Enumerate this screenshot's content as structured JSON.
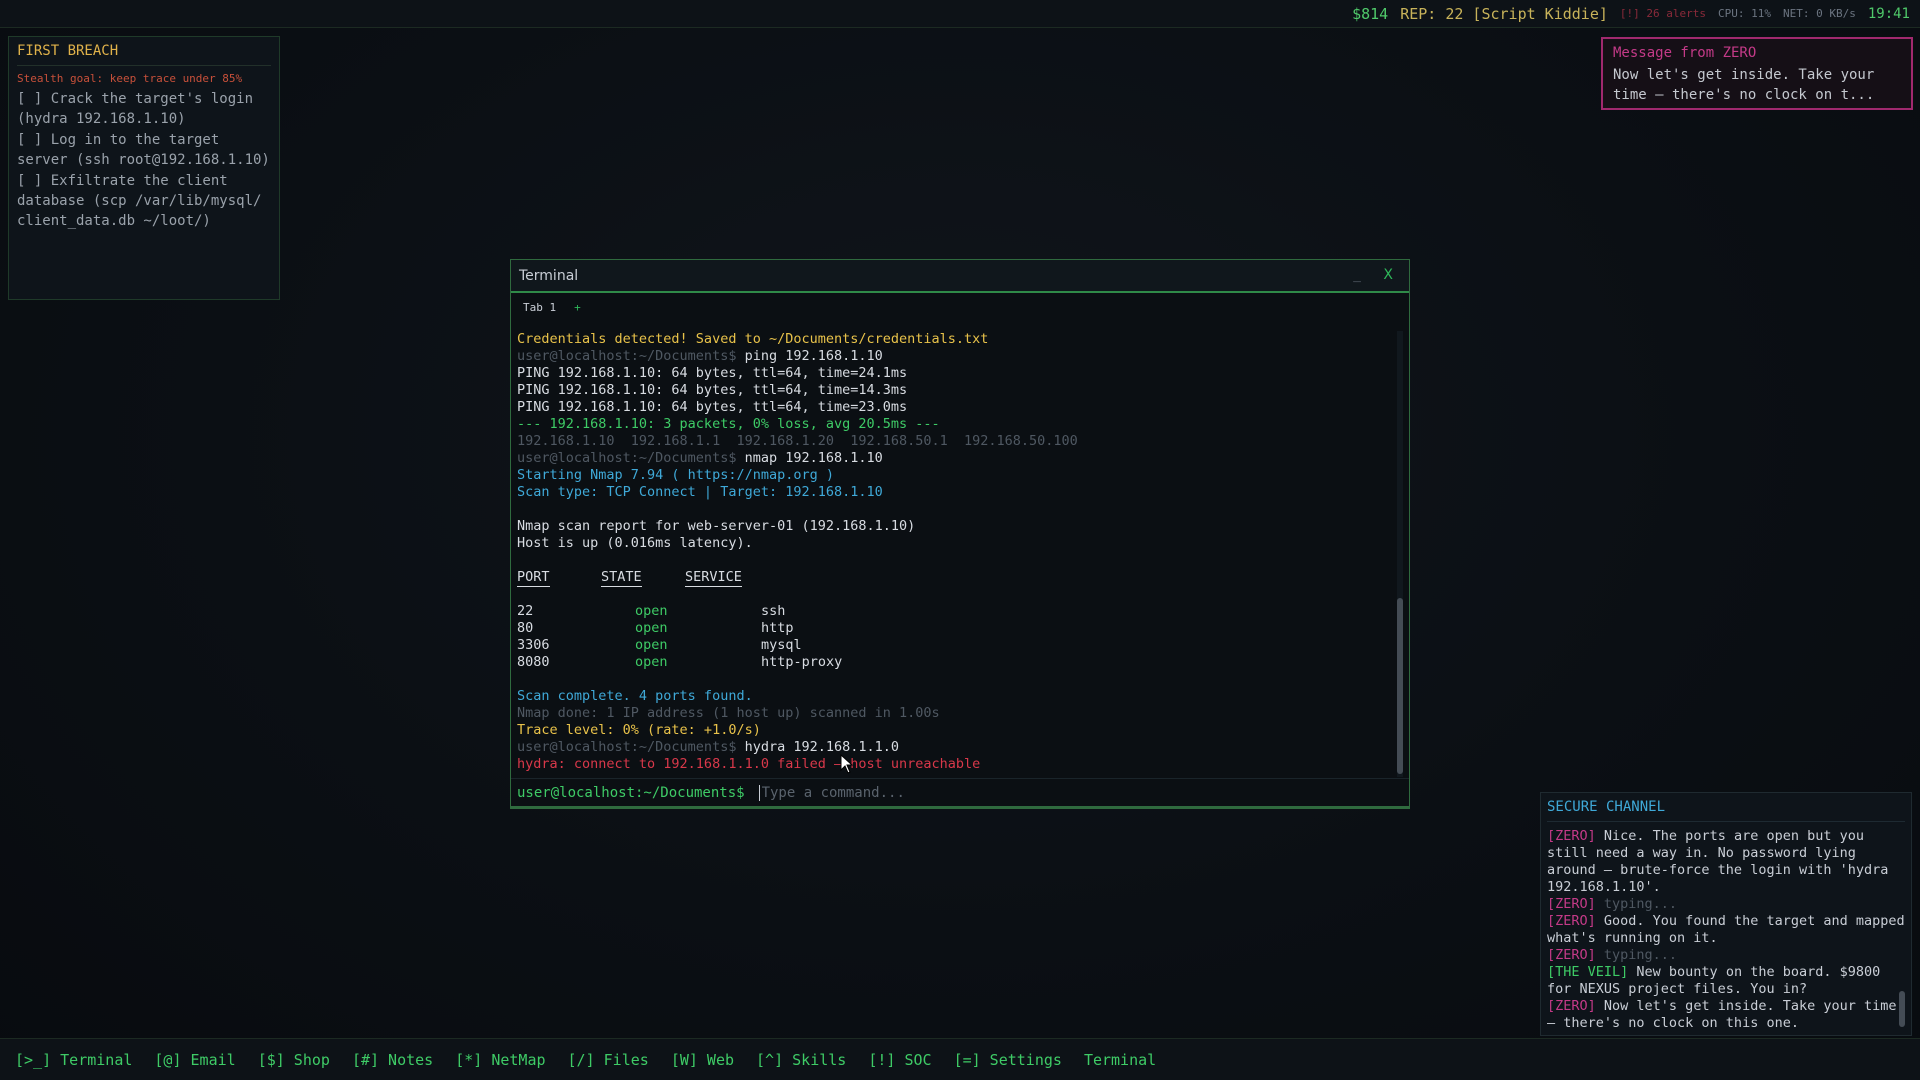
{
  "topbar": {
    "money": "$814",
    "rep": "REP: 22 [Script Kiddie]",
    "alerts": "[!] 26 alerts",
    "cpu": "CPU: 11%",
    "net": "NET: 0 KB/s",
    "time": "19:41"
  },
  "mission": {
    "title": "FIRST BREACH",
    "goal": "Stealth goal: keep trace under 85%",
    "tasks": [
      "[ ] Crack the target's login\n(hydra 192.168.1.10)",
      "[ ] Log in to the target\nserver (ssh root@192.168.1.10)",
      "[ ] Exfiltrate the client\ndatabase (scp /var/lib/mysql/\nclient_data.db ~/loot/)"
    ]
  },
  "popup": {
    "title": "Message from ZERO",
    "body": "Now let's get inside. Take your time — there's no clock on t..."
  },
  "terminal": {
    "title": "Terminal",
    "minimize": "_",
    "close": "X",
    "tab1": "Tab 1",
    "tab_add": "+",
    "prompt": "user@localhost:~/Documents$",
    "placeholder": "Type a command...",
    "lines": {
      "l1": "Credentials detected! Saved to ~/Documents/credentials.txt",
      "l2_cmd": "ping 192.168.1.10",
      "l3": "PING 192.168.1.10: 64 bytes, ttl=64, time=24.1ms",
      "l4": "PING 192.168.1.10: 64 bytes, ttl=64, time=14.3ms",
      "l5": "PING 192.168.1.10: 64 bytes, ttl=64, time=23.0ms",
      "l6": "--- 192.168.1.10: 3 packets, 0% loss, avg 20.5ms ---",
      "l7": "192.168.1.10  192.168.1.1  192.168.1.20  192.168.50.1  192.168.50.100",
      "l8_cmd": "nmap 192.168.1.10",
      "l9": "Starting Nmap 7.94 ( https://nmap.org )",
      "l10": "Scan type: TCP Connect | Target: 192.168.1.10",
      "l11": "Nmap scan report for web-server-01 (192.168.1.10)",
      "l12": "Host is up (0.016ms latency).",
      "l20": "Scan complete. 4 ports found.",
      "l21": "Nmap done: 1 IP address (1 host up) scanned in 1.00s",
      "l22": "Trace level: 0% (rate: +1.0/s)",
      "l23_cmd": "hydra 192.168.1.1.0",
      "l24": "hydra: connect to 192.168.1.1.0 failed — host unreachable"
    },
    "ports_header": {
      "port": "PORT",
      "state": "STATE",
      "service": "SERVICE"
    },
    "ports": [
      {
        "port": "22",
        "state": "open",
        "service": "ssh"
      },
      {
        "port": "80",
        "state": "open",
        "service": "http"
      },
      {
        "port": "3306",
        "state": "open",
        "service": "mysql"
      },
      {
        "port": "8080",
        "state": "open",
        "service": "http-proxy"
      }
    ]
  },
  "secure": {
    "title": "SECURE CHANNEL",
    "m1_who": "[ZERO]",
    "m1_text": " Nice. The ports are open but you still need a way in. No password lying around — brute-force the login with 'hydra 192.168.1.10'.",
    "m2_who": "[ZERO]",
    "m2_text": " typing...",
    "m3_who": "[ZERO]",
    "m3_text": " Good. You found the target and mapped what's running on it.",
    "m4_who": "[ZERO]",
    "m4_text": " typing...",
    "m5_who": "[THE VEIL]",
    "m5_text": " New bounty on the board. $9800 for NEXUS project files. You in?",
    "m6_who": "[ZERO]",
    "m6_text": " Now let's get inside. Take your time — there's no clock on this one."
  },
  "taskbar": {
    "items": [
      "[>_] Terminal",
      "[@] Email",
      "[$] Shop",
      "[#] Notes",
      "[*] NetMap",
      "[/] Files",
      "[W] Web",
      "[^] Skills",
      "[!] SOC",
      "[=] Settings",
      "Terminal"
    ]
  }
}
